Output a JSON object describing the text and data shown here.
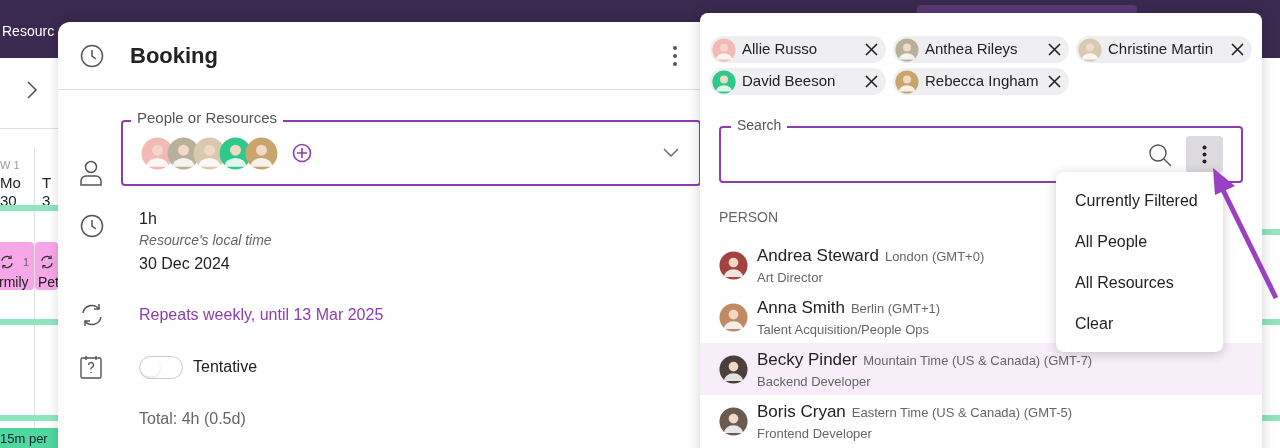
{
  "app_bar": {
    "title": "Resourc"
  },
  "calendar": {
    "week": "W 1",
    "days": [
      {
        "name": "Mo",
        "date": "30"
      },
      {
        "name": "T",
        "date": "3"
      }
    ],
    "events": [
      {
        "label": "rmily",
        "count": "1"
      },
      {
        "label": "Pet"
      }
    ],
    "footer_event": "15m per"
  },
  "booking": {
    "title": "Booking",
    "people_field": {
      "label": "People or Resources",
      "avatars": [
        {
          "kind": "avatar"
        },
        {
          "kind": "avatar"
        },
        {
          "kind": "avatar"
        },
        {
          "kind": "avatar"
        },
        {
          "kind": "avatar"
        }
      ]
    },
    "duration": "1h",
    "time_note": "Resource's local time",
    "date": "30 Dec 2024",
    "repeat": "Repeats weekly, until 13 Mar 2025",
    "tentative": {
      "label": "Tentative",
      "on": false
    },
    "total": "Total: 4h (0.5d)"
  },
  "picker": {
    "chips": [
      {
        "name": "Allie Russo"
      },
      {
        "name": "Anthea Rileys"
      },
      {
        "name": "Christine Martin"
      },
      {
        "name": "David Beeson"
      },
      {
        "name": "Rebecca Ingham"
      }
    ],
    "search": {
      "label": "Search"
    },
    "section": "PERSON",
    "people": [
      {
        "name": "Andrea Steward",
        "timezone": "London (GMT+0)",
        "role": "Art Director",
        "selected": false
      },
      {
        "name": "Anna Smith",
        "timezone": "Berlin (GMT+1)",
        "role": "Talent Acquisition/People Ops",
        "selected": false
      },
      {
        "name": "Becky Pinder",
        "timezone": "Mountain Time (US & Canada) (GMT-7)",
        "role": "Backend Developer",
        "selected": true
      },
      {
        "name": "Boris Cryan",
        "timezone": "Eastern Time (US & Canada) (GMT-5)",
        "role": "Frontend Developer",
        "selected": false
      }
    ],
    "menu": [
      "Currently Filtered",
      "All People",
      "All Resources",
      "Clear"
    ]
  }
}
